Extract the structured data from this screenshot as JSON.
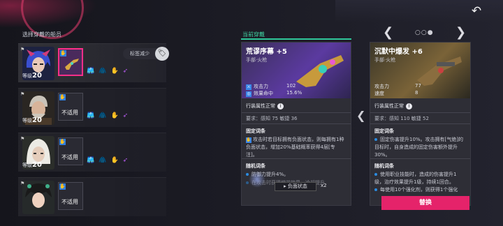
{
  "section_title": "选择穿戴的船员",
  "chip": {
    "label": "标签减少"
  },
  "crew": [
    {
      "level_prefix": "等级",
      "level": "20",
      "slot_text": ""
    },
    {
      "level_prefix": "等级",
      "level": "20",
      "slot_text": "不适用"
    },
    {
      "level_prefix": "等级",
      "level": "20",
      "slot_text": "不适用"
    },
    {
      "level_prefix": "",
      "level": "",
      "slot_text": "不适用"
    }
  ],
  "current": {
    "label": "当前穿戴",
    "name": "荒谬序幕 +5",
    "type": "手部·火枪",
    "stats": [
      {
        "label": "攻击力",
        "value": "102"
      },
      {
        "label": "效果命中",
        "value": "15.6%"
      }
    ],
    "attr_title": "行装属性正常",
    "requirement": "要求：感知 75 敏捷 36",
    "fixed_title": "固定词条",
    "fixed_affix": "攻击时若目标拥有负面状态，则每拥有1种负面状态，增加20%基础概率获得4层[专注]。",
    "random_title": "随机词条",
    "random_affixes": [
      "防御力提升4%。",
      "在攻击时获得增益效果，冷却提升"
    ],
    "negative_button": "负面状态",
    "negative_mult": "x2"
  },
  "new": {
    "name": "沉默中爆发 +6",
    "type": "手部·火枪",
    "stats": [
      {
        "label": "攻击力",
        "value": "77"
      },
      {
        "label": "速度",
        "value": "8"
      }
    ],
    "attr_title": "行装属性正常",
    "requirement": "要求：感知 110 敏捷 52",
    "fixed_title": "固定词条",
    "fixed_affix": "固定伤害提升10%。攻击拥有[气绝]的目标时，自身造成的固定伤害额外提升30%。",
    "random_title": "随机词条",
    "random_affixes": [
      "使用职业技能时，造成的伤害提升1级，治疗效果提升1级，持续1回合。",
      "每使用10个强化剂，则获得1个强化"
    ],
    "replace_button": "替换"
  },
  "pager": {
    "dots": "○○●",
    "prev": "❮",
    "next": "❯"
  },
  "icons": {
    "back": "back-arrow-icon",
    "compare": "compare-arrow-icon"
  },
  "colors": {
    "accent": "#e5236a",
    "selected_border": "#ff2f8a",
    "current_label": "#40d0a0"
  }
}
